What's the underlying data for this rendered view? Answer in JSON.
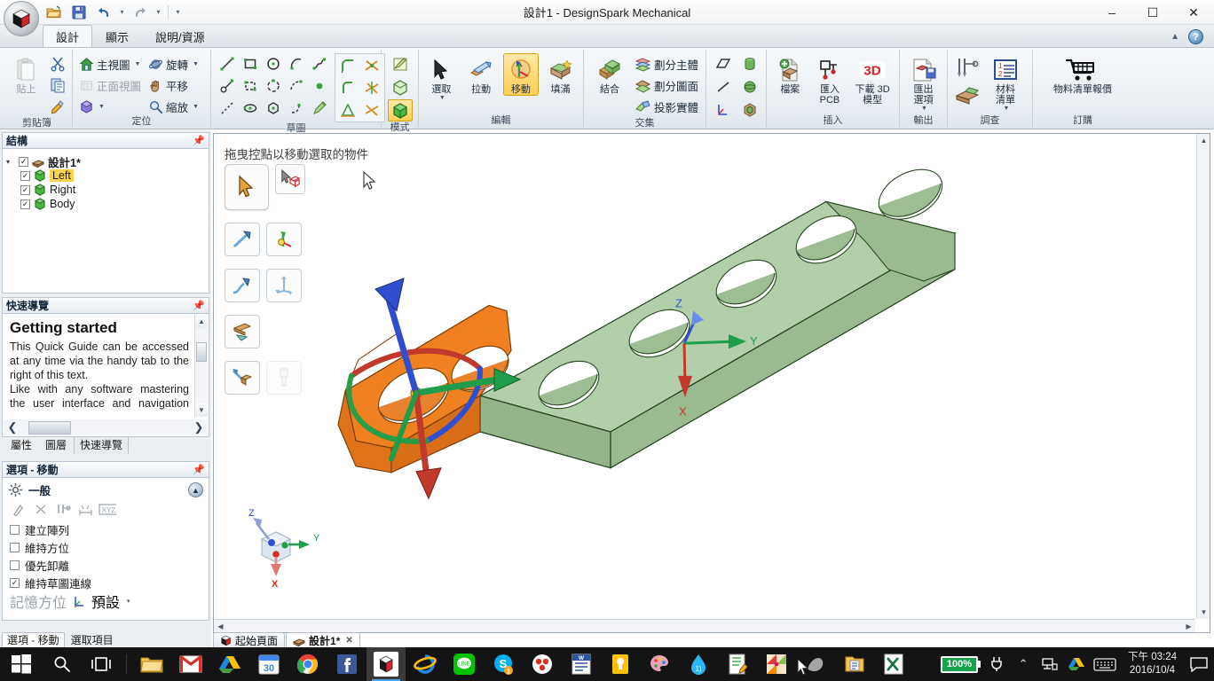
{
  "window": {
    "title": "設計1 - DesignSpark Mechanical",
    "minimize": "–",
    "maximize": "☐",
    "close": "✕"
  },
  "quick_access": {
    "open": "open-folder",
    "save": "save-disk",
    "undo": "undo-arrow",
    "redo": "redo-arrow",
    "more": "▾",
    "customize": "≡"
  },
  "ribbon_tabs": [
    {
      "label": "設計",
      "active": true
    },
    {
      "label": "顯示",
      "active": false
    },
    {
      "label": "說明/資源",
      "active": false
    }
  ],
  "ribbon_right": {
    "collapse": "▲",
    "help": "?"
  },
  "ribbon_groups": {
    "clipboard": {
      "title": "剪貼簿",
      "paste": "貼上",
      "cut": "cut-scissors",
      "copy": "copy-pages",
      "format": "format-brush"
    },
    "orient": {
      "title": "定位",
      "items": [
        {
          "label": "主視圖",
          "caret": true,
          "disabled": false
        },
        {
          "label": "旋轉",
          "caret": true,
          "disabled": false
        },
        {
          "label": "正面視圖",
          "caret": false,
          "disabled": true
        },
        {
          "label": "平移",
          "caret": false,
          "disabled": false
        },
        {
          "label": "",
          "caret": true,
          "disabled": false
        },
        {
          "label": "縮放",
          "caret": true,
          "disabled": false
        }
      ]
    },
    "sketch": {
      "title": "草圖",
      "tools": [
        "line-tool",
        "rectangle-tool",
        "circle-tool",
        "arc-tool",
        "polyline-tool",
        "tangent-line-tool",
        "polygon-tool",
        "three-point-arc-tool",
        "spline-arc-tool",
        "point-tool",
        "construction-line-tool",
        "ellipse-tool",
        "hexagon-tool",
        "curve-tool",
        "sketch-edit-tool"
      ],
      "modify": [
        "fillet-tool",
        "trim-tool",
        "corner-tool",
        "split-tool",
        "offset-tool",
        "extend-tool"
      ]
    },
    "mode": {
      "title": "模式",
      "items": [
        "sketch-mode",
        "section-mode",
        "solid-mode"
      ],
      "active_index": 2
    },
    "edit": {
      "title": "編輯",
      "items": [
        {
          "label": "選取",
          "icon": "select-arrow-icon",
          "caret": true,
          "active": false
        },
        {
          "label": "拉動",
          "icon": "pull-icon",
          "caret": false,
          "active": false
        },
        {
          "label": "移動",
          "icon": "move-icon",
          "caret": false,
          "active": true
        },
        {
          "label": "填滿",
          "icon": "fill-icon",
          "caret": false,
          "active": false
        }
      ]
    },
    "intersect": {
      "title": "交集",
      "combine": "結合",
      "items": [
        "劃分主體",
        "劃分圖面",
        "投影實體"
      ]
    },
    "primitives": {
      "items": [
        "plane-icon",
        "cylinder-icon",
        "line-icon",
        "sphere-icon",
        "axis-icon",
        "solid-icon"
      ]
    },
    "insert": {
      "title": "插入",
      "items": [
        {
          "label": "檔案",
          "icon": "insert-file-icon"
        },
        {
          "label": "匯入\nPCB",
          "icon": "import-pcb-icon"
        },
        {
          "label": "下載 3D\n模型",
          "icon": "download-3d-icon"
        }
      ]
    },
    "output": {
      "title": "輸出",
      "items": [
        {
          "label": "匯出\n選項",
          "icon": "export-icon",
          "caret": true
        }
      ]
    },
    "survey": {
      "title": "調查",
      "measure": "measure-caliper-icon",
      "mass": "mass-icon",
      "bom_icon": "bom-list-icon",
      "bom_label": "材料\n清單",
      "caret": true
    },
    "order": {
      "title": "訂購",
      "items": [
        {
          "label": "物料清單報價",
          "icon": "cart-icon"
        }
      ]
    }
  },
  "structure_panel": {
    "title": "結構",
    "pin": "pin-icon",
    "root": {
      "label": "設計1*",
      "checked": true,
      "expanded": true
    },
    "children": [
      {
        "label": "Left",
        "checked": true,
        "selected": true
      },
      {
        "label": "Right",
        "checked": true,
        "selected": false
      },
      {
        "label": "Body",
        "checked": true,
        "selected": false
      }
    ]
  },
  "quick_guide_panel": {
    "title": "快速導覽",
    "pin": "pin-icon",
    "heading": "Getting started",
    "paragraphs": [
      "This Quick Guide can be accessed at any time via the handy tab to the right of this text.",
      "Like with any software mastering the user interface and navigation takes a bit of practice. Please select a topic of"
    ],
    "tabs": [
      {
        "label": "屬性",
        "active": false
      },
      {
        "label": "圖層",
        "active": false
      },
      {
        "label": "快速導覽",
        "active": true
      }
    ]
  },
  "options_panel": {
    "title": "選項 - 移動",
    "pin": "pin-icon",
    "section": "一般",
    "section_icon": "gear-icon",
    "collapse": "▲",
    "tool_icons": [
      "anchor-icon",
      "detach-icon",
      "ruler-icon",
      "measure-icon",
      "xyz-icon"
    ],
    "checkboxes": [
      {
        "label": "建立陣列",
        "checked": false
      },
      {
        "label": "維持方位",
        "checked": false
      },
      {
        "label": "優先卸離",
        "checked": false
      },
      {
        "label": "維持草圖連線",
        "checked": true
      }
    ],
    "memory_label": "記憶方位",
    "memory_value": "預設",
    "memory_icon": "axis-icon",
    "memory_caret": "▾"
  },
  "dock_tabs": [
    {
      "label": "選項 - 移動",
      "active": true
    },
    {
      "label": "選取項目",
      "active": false
    }
  ],
  "viewport": {
    "hint": "拖曳控點以移動選取的物件",
    "palette": [
      {
        "name": "select-handle-tool",
        "active": true
      },
      {
        "name": "select-object-tool",
        "active": false
      },
      {
        "name": "move-direction-tool",
        "active": false
      },
      {
        "name": "anchor-point-tool",
        "active": false
      },
      {
        "name": "move-along-curve-tool",
        "active": false
      },
      {
        "name": "move-three-axis-tool",
        "active": false
      },
      {
        "name": "ruler-dimension-tool",
        "active": false
      },
      {
        "name": "detach-move-tool",
        "active": false
      },
      {
        "name": "paste-ghost-tool",
        "active": false
      }
    ],
    "triad": {
      "x": "X",
      "y": "Y",
      "z": "Z"
    },
    "gizmo": {
      "x": "X",
      "z": "Z",
      "y": "Y"
    }
  },
  "doc_tabs": [
    {
      "label": "起始頁面",
      "active": false,
      "closable": false,
      "icon": "cube-icon"
    },
    {
      "label": "設計1*",
      "active": true,
      "closable": true,
      "icon": "design-icon"
    }
  ],
  "taskbar": {
    "start": "windows-start-icon",
    "search": "search-icon",
    "taskview": "task-view-icon",
    "apps": [
      {
        "name": "file-explorer-icon"
      },
      {
        "name": "gmail-icon"
      },
      {
        "name": "google-drive-icon"
      },
      {
        "name": "calendar-icon",
        "badge": "30"
      },
      {
        "name": "chrome-icon"
      },
      {
        "name": "facebook-icon"
      },
      {
        "name": "designspark-icon",
        "active": true
      },
      {
        "name": "internet-explorer-icon"
      },
      {
        "name": "line-icon"
      },
      {
        "name": "skype-icon",
        "badge": "1"
      },
      {
        "name": "app-icon"
      },
      {
        "name": "word-icon"
      },
      {
        "name": "keep-icon"
      },
      {
        "name": "paint-icon"
      },
      {
        "name": "water-icon"
      },
      {
        "name": "notepad-icon"
      },
      {
        "name": "photos-icon"
      },
      {
        "name": "sketch-icon"
      },
      {
        "name": "folder-doc-icon"
      },
      {
        "name": "excel-icon"
      }
    ],
    "tray": {
      "battery": "100%",
      "power": "power-plug-icon",
      "chevron": "⌃",
      "network": "network-icon",
      "drive": "google-drive-tray-icon",
      "keyboard": "keyboard-icon",
      "time": "下午 03:24",
      "date": "2016/10/4",
      "notifications": "notification-icon"
    }
  },
  "colors": {
    "accent_orange": "#F08020",
    "model_green": "#AECBA4",
    "model_green_dark": "#8FAE87",
    "highlight_yellow": "#FFD24D",
    "axis_x": "#D93025",
    "axis_y": "#1E9E4A",
    "axis_z": "#2F4FD0",
    "taskbar_bg": "#141414",
    "battery_green": "#16A34A"
  }
}
